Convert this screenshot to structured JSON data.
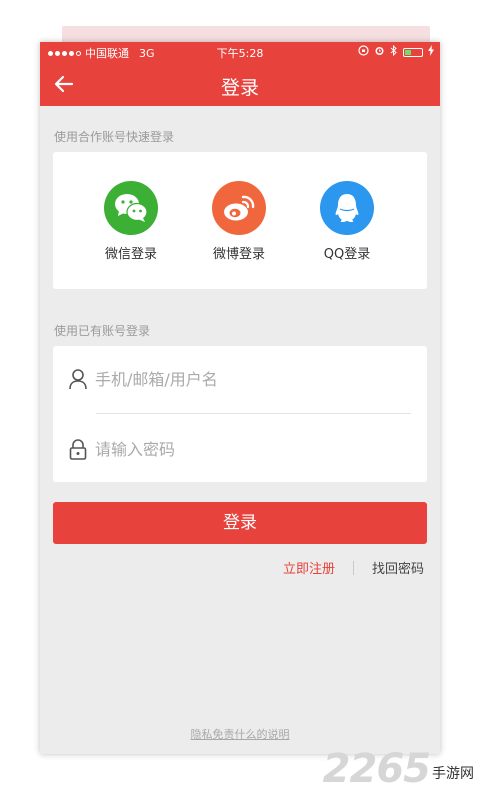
{
  "status": {
    "carrier": "中国联通",
    "network": "3G",
    "time": "下午5:28",
    "battery_level": 0.35
  },
  "nav": {
    "title": "登录"
  },
  "social_section": {
    "label": "使用合作账号快速登录",
    "items": [
      {
        "label": "微信登录",
        "icon": "wechat-icon",
        "color": "#3cb034"
      },
      {
        "label": "微博登录",
        "icon": "weibo-icon",
        "color": "#f0663d"
      },
      {
        "label": "QQ登录",
        "icon": "qq-icon",
        "color": "#2c97ee"
      }
    ]
  },
  "account_section": {
    "label": "使用已有账号登录",
    "username_placeholder": "手机/邮箱/用户名",
    "password_placeholder": "请输入密码"
  },
  "login_button": "登录",
  "links": {
    "register": "立即注册",
    "forgot": "找回密码"
  },
  "footer": {
    "privacy": "隐私免责什么的说明"
  },
  "watermark": {
    "number": "2265",
    "text": "手游网"
  },
  "colors": {
    "accent": "#e8423d",
    "background": "#ececec"
  }
}
